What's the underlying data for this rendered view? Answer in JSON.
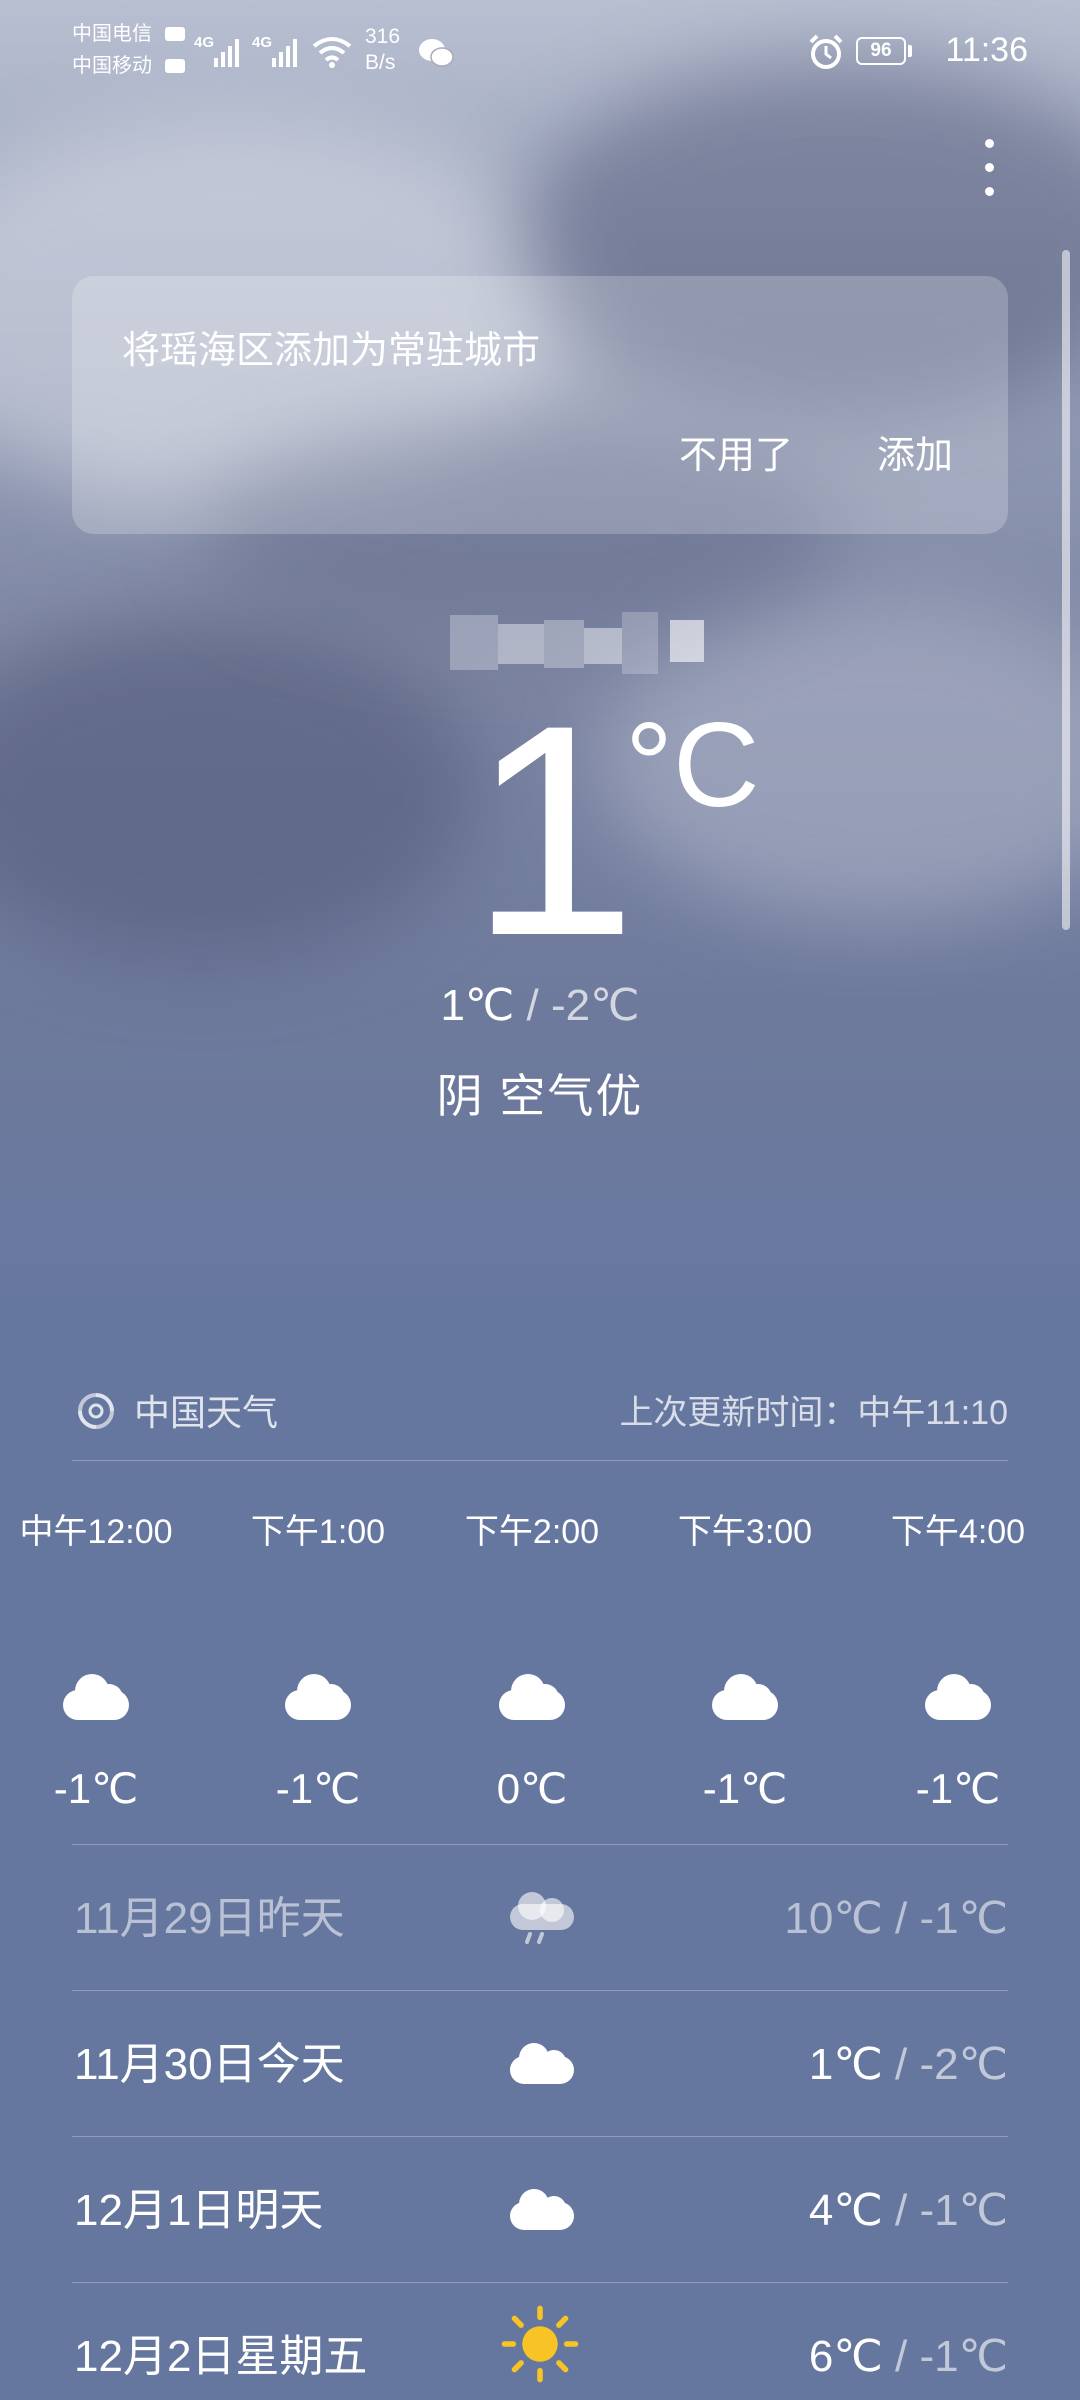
{
  "status_bar": {
    "carrier_1": "中国电信",
    "carrier_2": "中国移动",
    "network_1": "4G",
    "network_2": "4G",
    "speed_value": "316",
    "speed_unit": "B/s",
    "battery": "96",
    "time": "11:36",
    "icons": [
      "hd-icon",
      "signal-icon",
      "wifi-icon",
      "wechat-icon",
      "alarm-icon",
      "battery-icon"
    ]
  },
  "card": {
    "message": "将瑶海区添加为常驻城市",
    "decline_label": "不用了",
    "add_label": "添加"
  },
  "current": {
    "temperature": "1",
    "unit": "°C",
    "high": "1℃",
    "separator": " / ",
    "low": "-2℃",
    "condition": "阴  空气优"
  },
  "source": {
    "name": "中国天气",
    "update_time": "上次更新时间：中午11:10"
  },
  "hourly": [
    {
      "time": "中午12:00",
      "temp": "-1℃",
      "icon": "cloud-icon"
    },
    {
      "time": "下午1:00",
      "temp": "-1℃",
      "icon": "cloud-icon"
    },
    {
      "time": "下午2:00",
      "temp": "0℃",
      "icon": "cloud-icon"
    },
    {
      "time": "下午3:00",
      "temp": "-1℃",
      "icon": "cloud-icon"
    },
    {
      "time": "下午4:00",
      "temp": "-1℃",
      "icon": "cloud-icon"
    }
  ],
  "daily": [
    {
      "label": "11月29日昨天",
      "high": "10℃",
      "sep": " / ",
      "low": "-1℃",
      "icon": "rain-cloud-icon"
    },
    {
      "label": "11月30日今天",
      "high": "1℃",
      "sep": " / ",
      "low": "-2℃",
      "icon": "cloud-icon"
    },
    {
      "label": "12月1日明天",
      "high": "4℃",
      "sep": " / ",
      "low": "-1℃",
      "icon": "cloud-icon"
    },
    {
      "label": "12月2日星期五",
      "high": "6℃",
      "sep": " / ",
      "low": "-1℃",
      "icon": "sun-icon"
    }
  ],
  "colors": {
    "background_bottom": "#66779f",
    "sun": "#f7c325"
  }
}
